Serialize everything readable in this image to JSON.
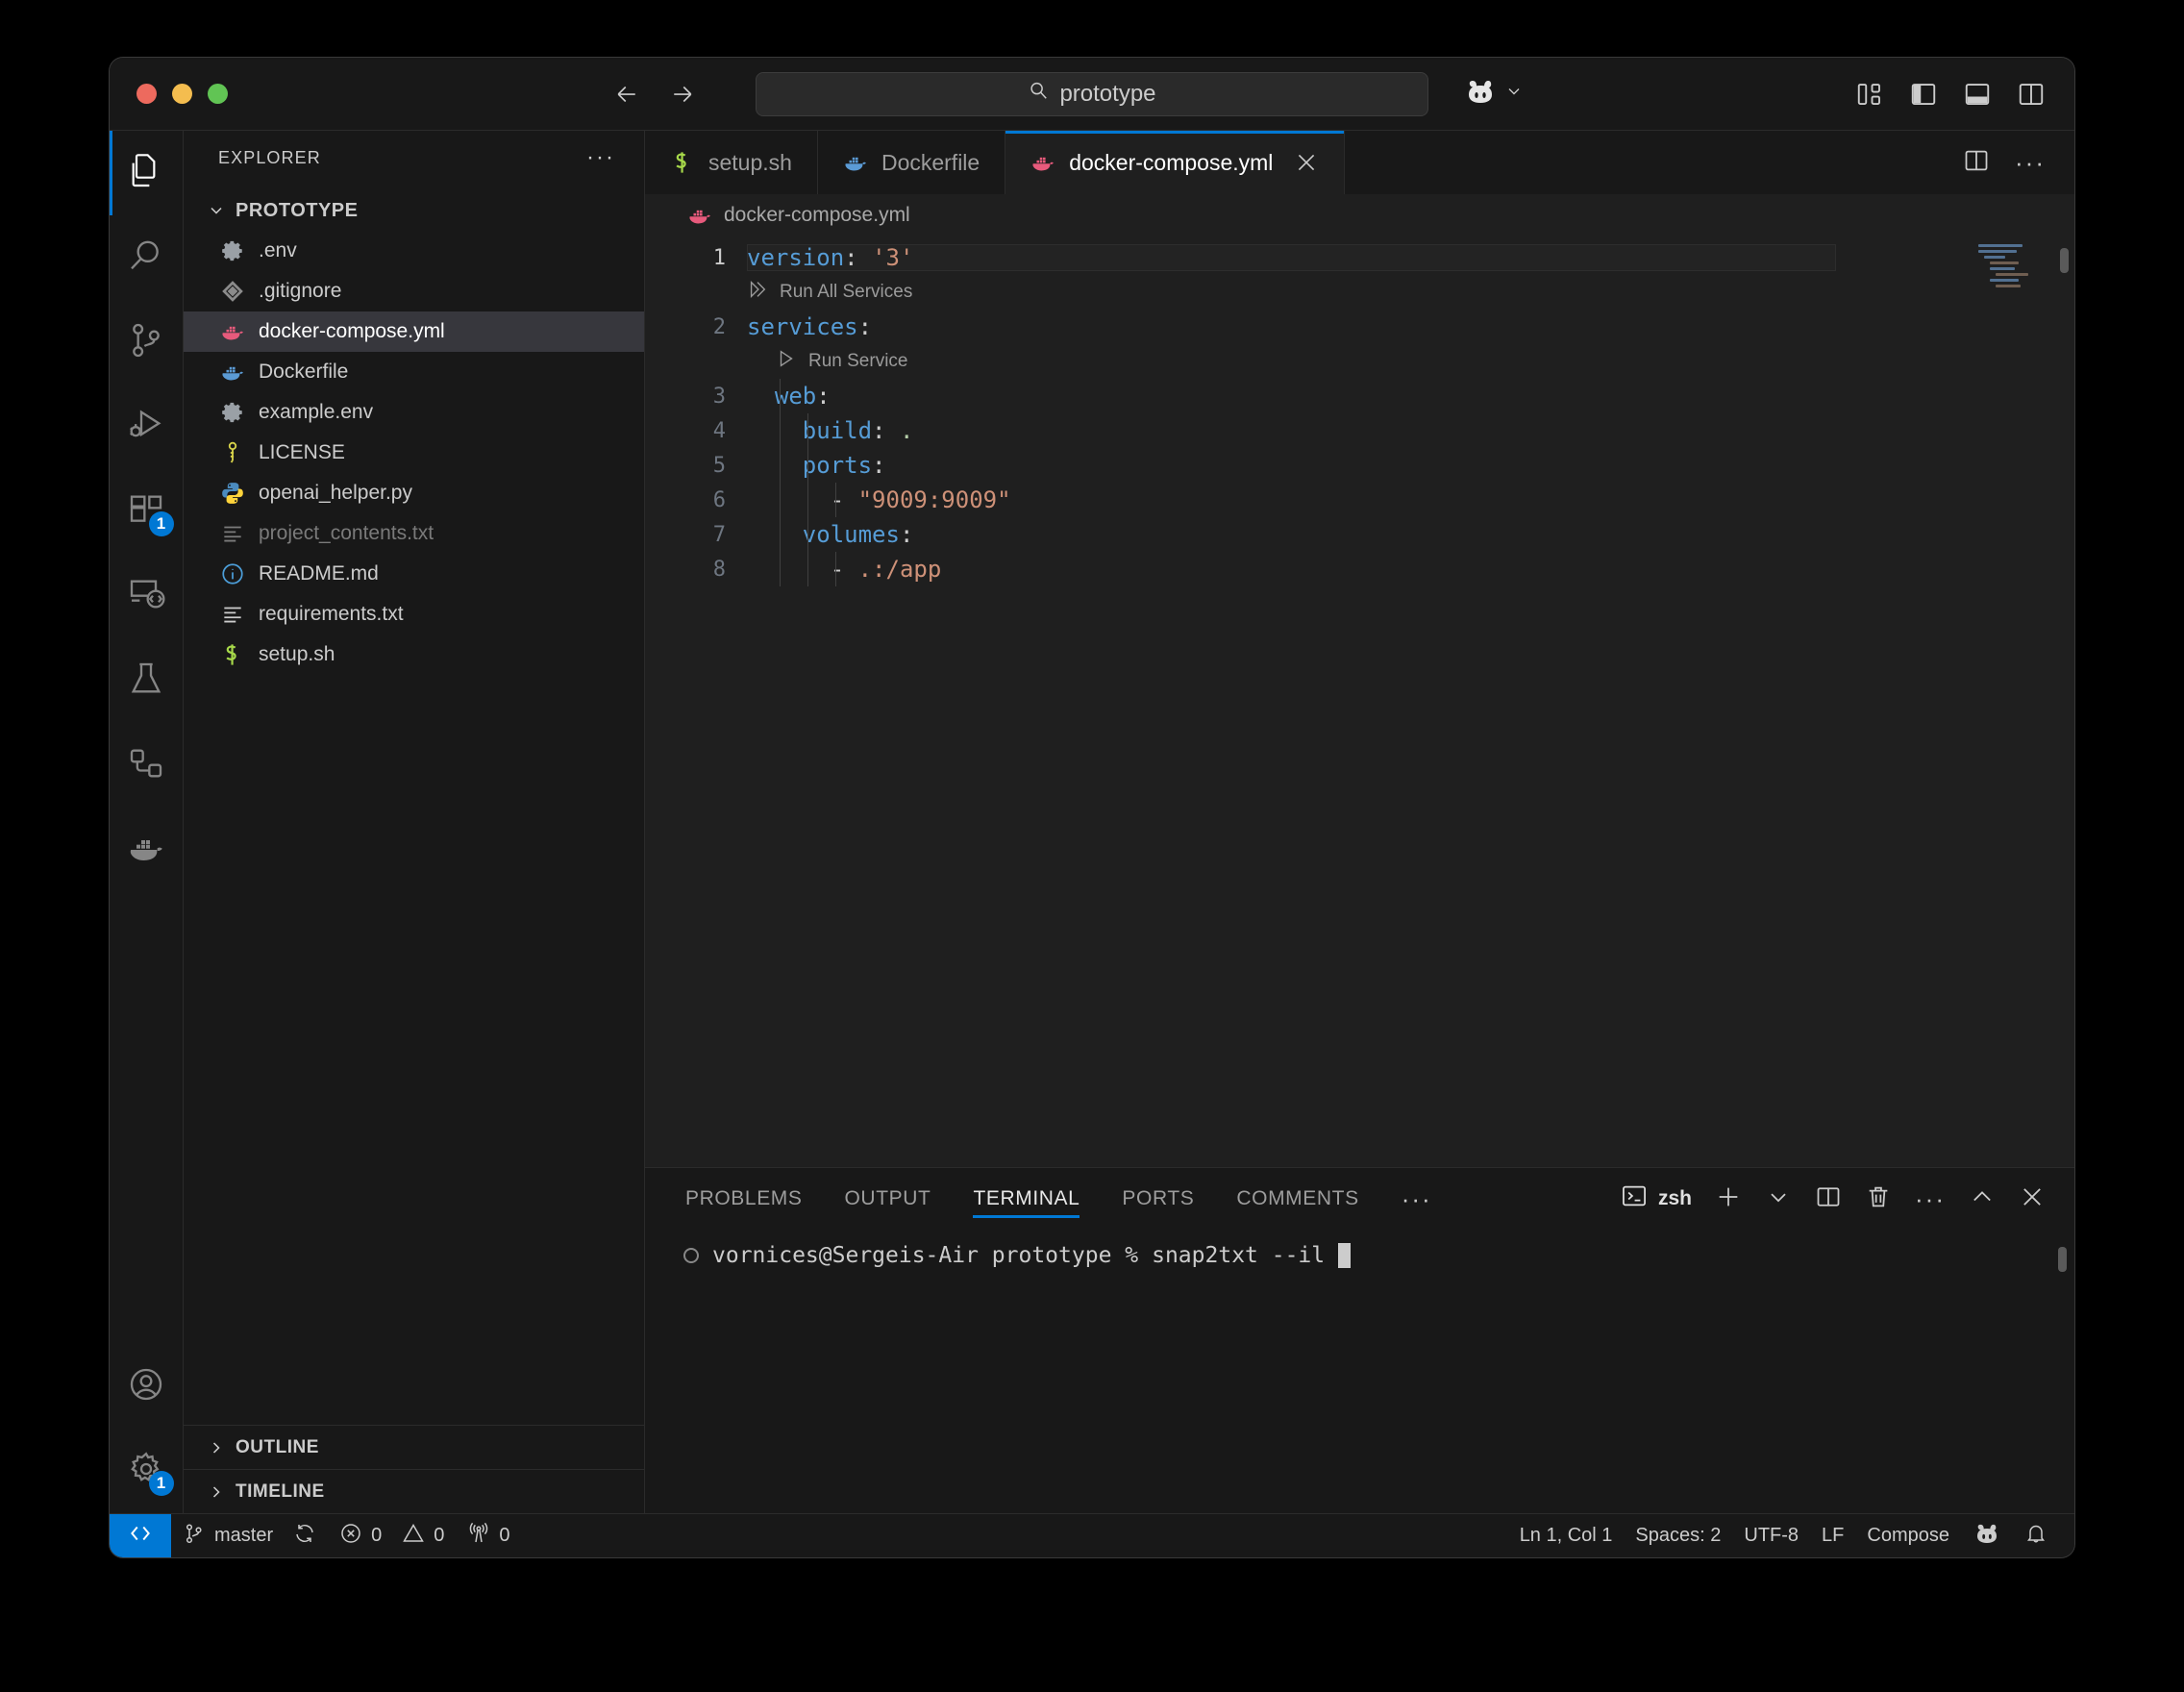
{
  "titlebar": {
    "search_text": "prototype",
    "search_icon": "search-icon",
    "back_icon": "arrow-left-icon",
    "forward_icon": "arrow-right-icon",
    "copilot_icon": "copilot-icon",
    "copilot_chevron_icon": "chevron-down-icon",
    "layout_buttons": [
      {
        "name": "customize-layout-icon",
        "label": ""
      },
      {
        "name": "toggle-primary-sidebar-icon",
        "label": ""
      },
      {
        "name": "toggle-panel-icon",
        "label": ""
      },
      {
        "name": "toggle-secondary-sidebar-icon",
        "label": ""
      }
    ]
  },
  "activitybar": {
    "items": [
      {
        "name": "explorer",
        "icon": "files-icon",
        "active": true,
        "badge": ""
      },
      {
        "name": "search",
        "icon": "search-icon",
        "active": false,
        "badge": ""
      },
      {
        "name": "source-control",
        "icon": "source-control-icon",
        "active": false,
        "badge": ""
      },
      {
        "name": "run-and-debug",
        "icon": "run-debug-icon",
        "active": false,
        "badge": ""
      },
      {
        "name": "extensions",
        "icon": "extensions-icon",
        "active": false,
        "badge": "1"
      },
      {
        "name": "remote-explorer",
        "icon": "remote-explorer-icon",
        "active": false,
        "badge": ""
      },
      {
        "name": "testing",
        "icon": "beaker-icon",
        "active": false,
        "badge": ""
      },
      {
        "name": "dev-containers",
        "icon": "dev-containers-icon",
        "active": false,
        "badge": ""
      },
      {
        "name": "docker",
        "icon": "docker-whale-icon",
        "active": false,
        "badge": ""
      }
    ],
    "bottom_items": [
      {
        "name": "accounts",
        "icon": "account-icon",
        "badge": ""
      },
      {
        "name": "manage-settings",
        "icon": "gear-icon",
        "badge": "1"
      }
    ]
  },
  "sidebar": {
    "title": "EXPLORER",
    "more_actions_label": "···",
    "root": {
      "label": "PROTOTYPE",
      "expanded": true
    },
    "files": [
      {
        "name": ".env",
        "icon": "gear-file-icon",
        "selected": false,
        "dim": false
      },
      {
        "name": ".gitignore",
        "icon": "git-file-icon",
        "selected": false,
        "dim": false
      },
      {
        "name": "docker-compose.yml",
        "icon": "docker-pink-icon",
        "selected": true,
        "dim": false
      },
      {
        "name": "Dockerfile",
        "icon": "docker-blue-icon",
        "selected": false,
        "dim": false
      },
      {
        "name": "example.env",
        "icon": "gear-file-icon",
        "selected": false,
        "dim": false
      },
      {
        "name": "LICENSE",
        "icon": "key-icon",
        "selected": false,
        "dim": false
      },
      {
        "name": "openai_helper.py",
        "icon": "python-icon",
        "selected": false,
        "dim": false
      },
      {
        "name": "project_contents.txt",
        "icon": "text-file-icon",
        "selected": false,
        "dim": true
      },
      {
        "name": "README.md",
        "icon": "info-icon",
        "selected": false,
        "dim": false
      },
      {
        "name": "requirements.txt",
        "icon": "text-file-icon",
        "selected": false,
        "dim": false
      },
      {
        "name": "setup.sh",
        "icon": "shell-icon",
        "selected": false,
        "dim": false
      }
    ],
    "sections": [
      {
        "label": "OUTLINE",
        "expanded": false
      },
      {
        "label": "TIMELINE",
        "expanded": false
      }
    ]
  },
  "editor": {
    "tabs": [
      {
        "label": "setup.sh",
        "icon": "shell-icon",
        "active": false,
        "closable": false
      },
      {
        "label": "Dockerfile",
        "icon": "docker-blue-icon",
        "active": false,
        "closable": false
      },
      {
        "label": "docker-compose.yml",
        "icon": "docker-pink-icon",
        "active": true,
        "closable": true
      }
    ],
    "tab_actions": [
      {
        "name": "split-editor-right-icon"
      },
      {
        "name": "editor-more-actions-icon",
        "label": "···"
      }
    ],
    "breadcrumb": {
      "icon": "docker-pink-icon",
      "label": "docker-compose.yml"
    },
    "lines": [
      {
        "num": "1",
        "text": "version: '3'",
        "current": true
      },
      {
        "num": "2",
        "text": "services:",
        "current": false
      },
      {
        "num": "3",
        "text": "  web:",
        "current": false
      },
      {
        "num": "4",
        "text": "    build: .",
        "current": false
      },
      {
        "num": "5",
        "text": "    ports:",
        "current": false
      },
      {
        "num": "6",
        "text": "      - \"9009:9009\"",
        "current": false
      },
      {
        "num": "7",
        "text": "    volumes:",
        "current": false
      },
      {
        "num": "8",
        "text": "      - .:/app",
        "current": false
      }
    ],
    "codelens": [
      {
        "label": "Run All Services",
        "icon": "run-all-icon",
        "after_line": "1"
      },
      {
        "label": "Run Service",
        "icon": "run-icon",
        "after_line": "2"
      }
    ]
  },
  "panel": {
    "tabs": [
      {
        "label": "PROBLEMS",
        "active": false
      },
      {
        "label": "OUTPUT",
        "active": false
      },
      {
        "label": "TERMINAL",
        "active": true
      },
      {
        "label": "PORTS",
        "active": false
      },
      {
        "label": "COMMENTS",
        "active": false
      }
    ],
    "tabs_more": "···",
    "shell_label": "zsh",
    "actions": [
      {
        "name": "new-terminal-icon"
      },
      {
        "name": "terminal-profile-chevron-icon"
      },
      {
        "name": "split-terminal-icon"
      },
      {
        "name": "kill-terminal-icon"
      },
      {
        "name": "terminal-more-actions-icon",
        "label": "···"
      },
      {
        "name": "maximize-panel-icon"
      },
      {
        "name": "close-panel-icon"
      }
    ],
    "terminal": {
      "prompt": "vornices@Sergeis-Air prototype % ",
      "command": "snap2txt --il"
    }
  },
  "statusbar": {
    "remote_icon": "remote-window-icon",
    "left": [
      {
        "name": "branch",
        "icon": "git-branch-icon",
        "label": "master"
      },
      {
        "name": "sync",
        "icon": "sync-icon",
        "label": ""
      },
      {
        "name": "errors",
        "icon": "error-icon",
        "label": "0"
      },
      {
        "name": "warnings",
        "icon": "warning-icon",
        "label": "0"
      },
      {
        "name": "ports",
        "icon": "radio-tower-icon",
        "label": "0"
      }
    ],
    "right": [
      {
        "name": "cursor-position",
        "label": "Ln 1, Col 1"
      },
      {
        "name": "indentation",
        "label": "Spaces: 2"
      },
      {
        "name": "encoding",
        "label": "UTF-8"
      },
      {
        "name": "eol",
        "label": "LF"
      },
      {
        "name": "language-mode",
        "label": "Compose"
      },
      {
        "name": "copilot-status",
        "label": "",
        "icon": "copilot-icon"
      },
      {
        "name": "notifications",
        "label": "",
        "icon": "bell-icon"
      }
    ]
  },
  "colors": {
    "accent": "#0078d4",
    "background": "#1f1f1f",
    "chrome": "#181818",
    "selected_row": "#37373d",
    "docker_pink": "#e75a7c",
    "docker_blue": "#5b9bd5"
  }
}
